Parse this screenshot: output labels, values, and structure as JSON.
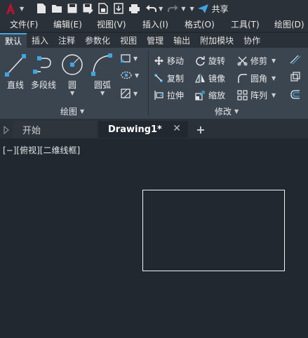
{
  "quick_access": {
    "share_label": "共享",
    "accent": "#c8102e",
    "share_color": "#3da6e0"
  },
  "menu": [
    "文件(F)",
    "编辑(E)",
    "视图(V)",
    "插入(I)",
    "格式(O)",
    "工具(T)",
    "绘图(D)"
  ],
  "ribbon_tabs": [
    "默认",
    "插入",
    "注释",
    "参数化",
    "视图",
    "管理",
    "输出",
    "附加模块",
    "协作"
  ],
  "draw_panel": {
    "title": "绘图",
    "line": "直线",
    "polyline": "多段线",
    "circle": "圆",
    "arc": "圆弧"
  },
  "modify_panel": {
    "title": "修改",
    "move": "移动",
    "rotate": "旋转",
    "trim": "修剪",
    "copy": "复制",
    "mirror": "镜像",
    "fillet": "圆角",
    "stretch": "拉伸",
    "scale": "缩放",
    "array": "阵列"
  },
  "doc_tabs": {
    "start": "开始",
    "drawing": "Drawing1*",
    "new_tab": "+"
  },
  "viewport": {
    "label": "[−][俯视][二维线框]"
  }
}
